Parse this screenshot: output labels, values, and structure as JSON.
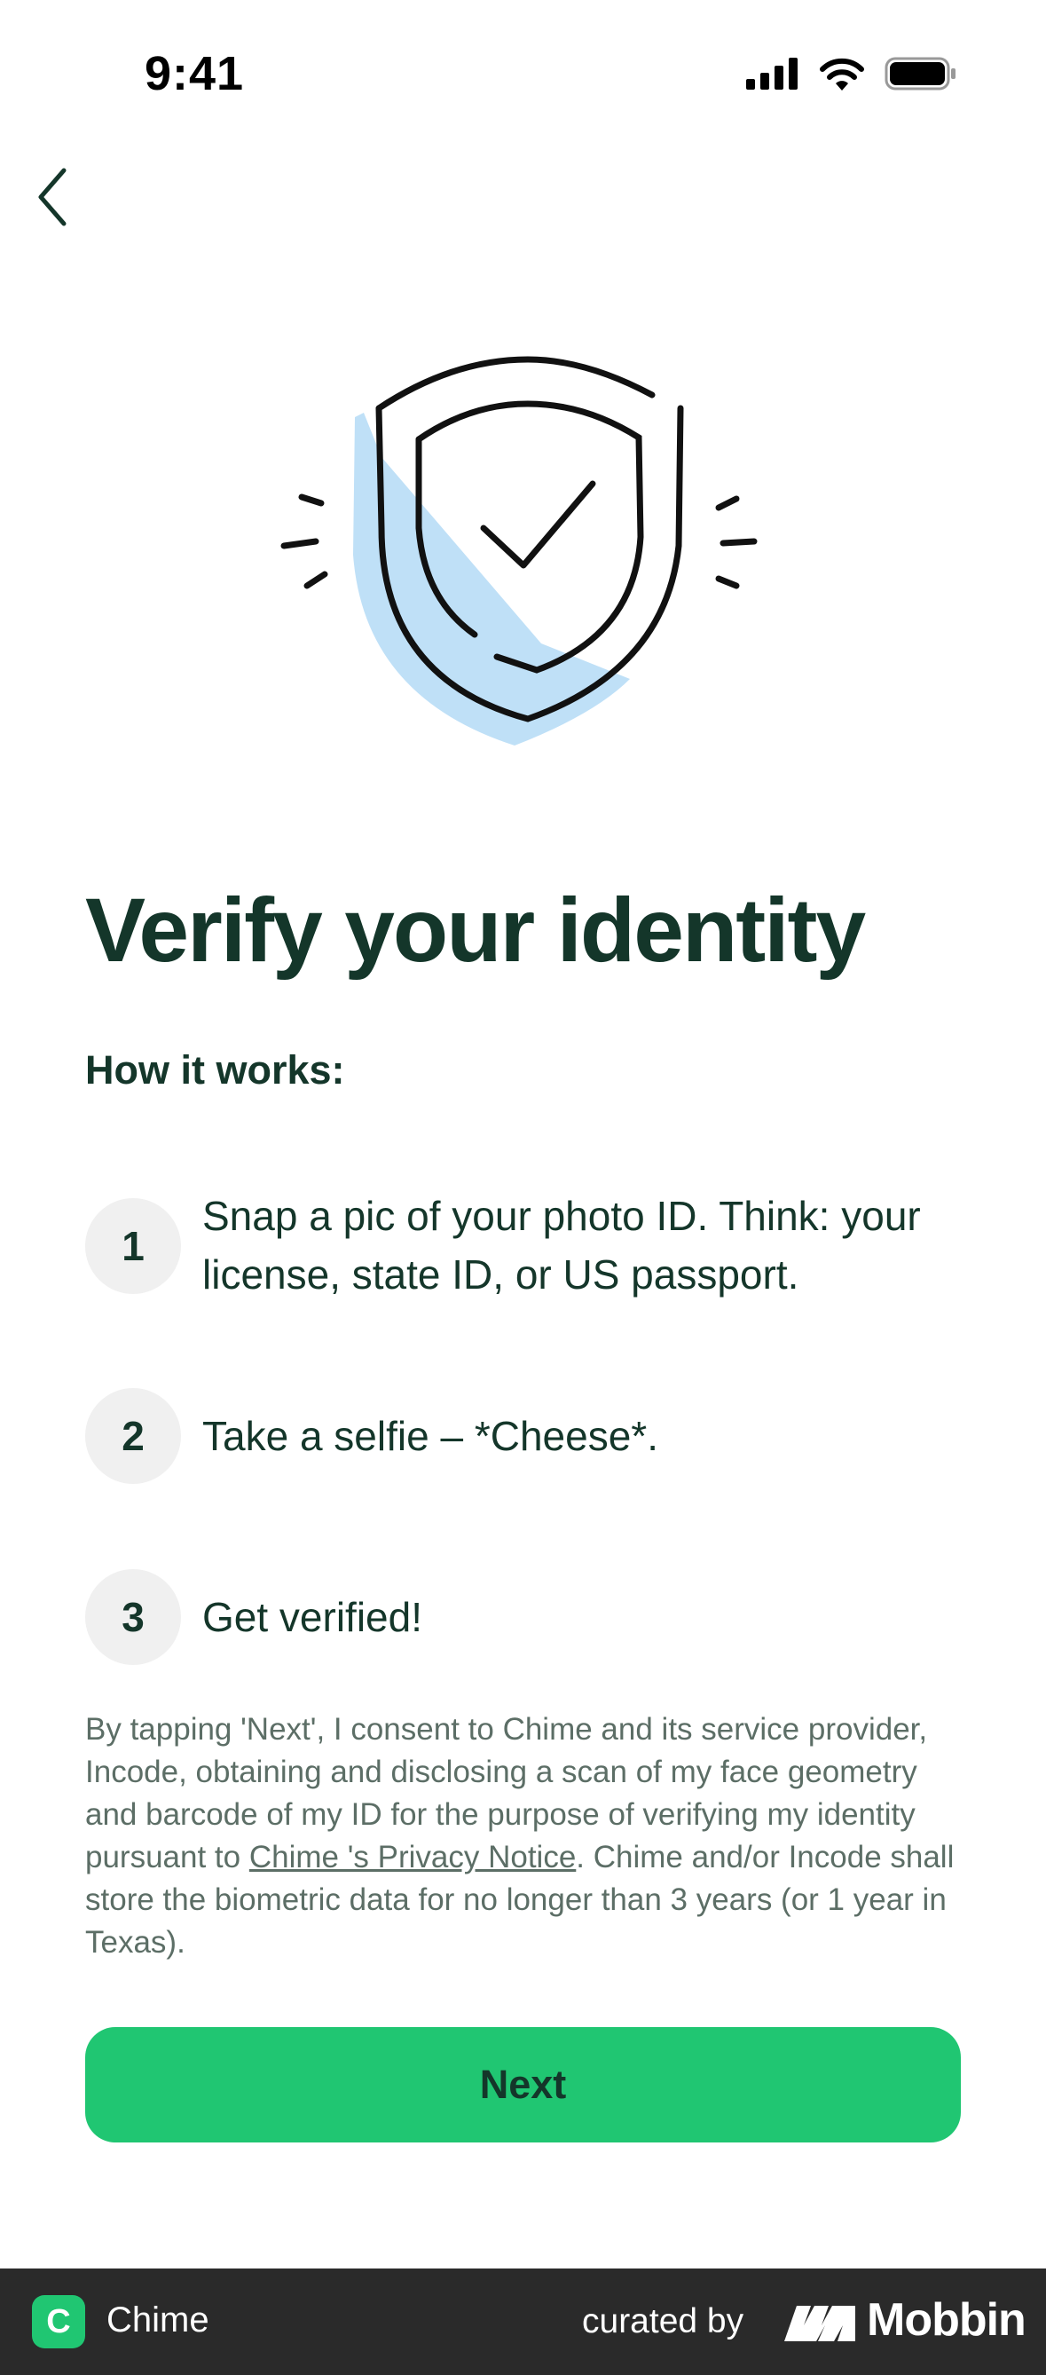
{
  "status_bar": {
    "time": "9:41",
    "icons": [
      "cellular-signal-icon",
      "wifi-icon",
      "battery-icon"
    ]
  },
  "nav": {
    "back_icon": "chevron-left-icon"
  },
  "hero": {
    "illustration": "shield-check-icon",
    "accent_color": "#bfe0f7"
  },
  "title": "Verify your identity",
  "subtitle": "How it works:",
  "steps": [
    {
      "number": "1",
      "line1": "Snap a pic of your photo ID. Think: your",
      "line2": "license, state ID, or US passport."
    },
    {
      "number": "2",
      "text": "Take a selfie – *Cheese*."
    },
    {
      "number": "3",
      "text": "Get verified!"
    }
  ],
  "consent": {
    "before_link": "By tapping 'Next', I consent to Chime and its service provider, Incode, obtaining and disclosing a scan of my face geometry and barcode of my ID for the purpose of verifying my identity pursuant to ",
    "link": "Chime 's Privacy Notice",
    "after_link": ". Chime and/or Incode shall store the biometric data for no longer than 3 years (or 1 year in Texas)."
  },
  "next_button": {
    "label": "Next",
    "color": "#20c672"
  },
  "footer": {
    "app_icon_letter": "C",
    "app_name": "Chime",
    "curated_by": "curated by",
    "brand": "Mobbin"
  }
}
